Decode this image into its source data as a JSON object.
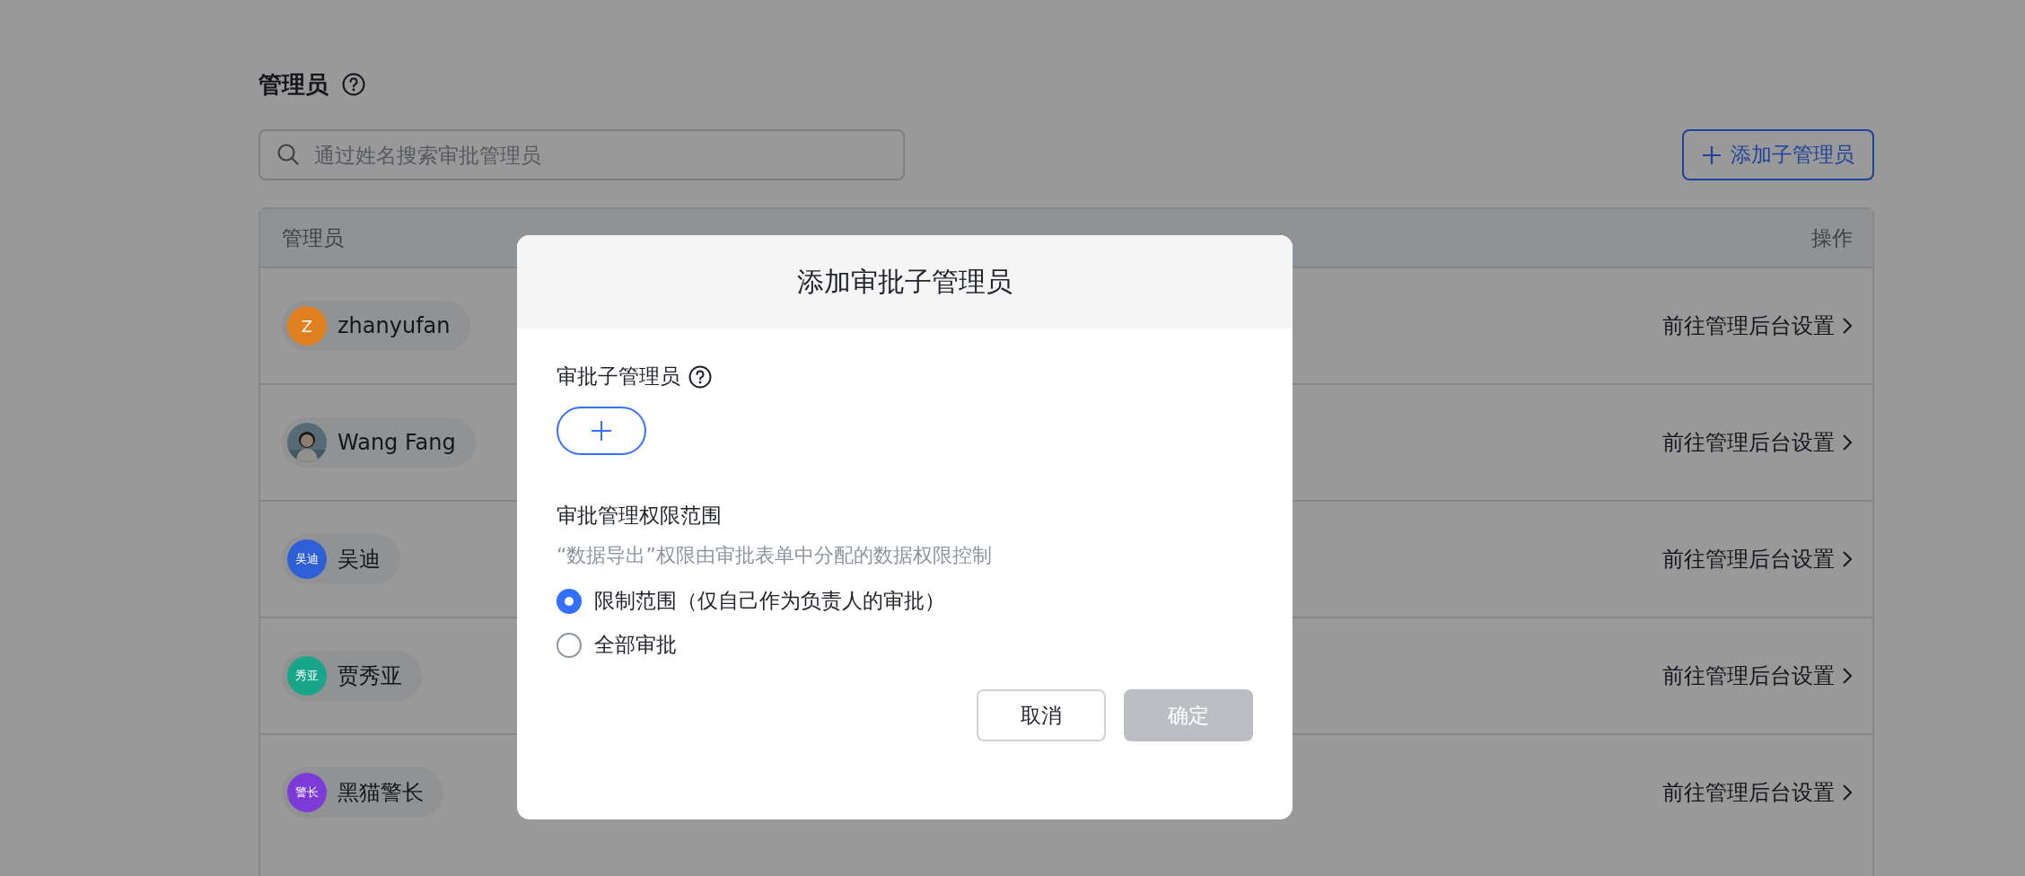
{
  "page": {
    "title": "管理员",
    "search": {
      "placeholder": "通过姓名搜索审批管理员"
    },
    "add_button": "添加子管理员"
  },
  "table": {
    "columns": [
      "管理员",
      "操作"
    ],
    "rows": [
      {
        "name": "zhanyufan",
        "avatar": {
          "kind": "initials",
          "text": "Z",
          "color": "#e07f1f"
        },
        "action": "前往管理后台设置"
      },
      {
        "name": "Wang Fang",
        "action": "前往管理后台设置"
      },
      {
        "name": "吴迪",
        "avatar": {
          "kind": "initials",
          "text": "吴迪",
          "color": "#2f5fd6"
        },
        "action": "前往管理后台设置"
      },
      {
        "name": "贾秀亚",
        "avatar": {
          "kind": "initials",
          "text": "秀亚",
          "color": "#17a68a"
        },
        "action": "前往管理后台设置"
      },
      {
        "name": "黑猫警长",
        "avatar": {
          "kind": "initials",
          "text": "警长",
          "color": "#7c3bd6"
        },
        "action": "前往管理后台设置"
      }
    ]
  },
  "dialog": {
    "title": "添加审批子管理员",
    "field_label": "审批子管理员",
    "scope_label": "审批管理权限范围",
    "scope_hint": "“数据导出”权限由审批表单中分配的数据权限控制",
    "options": [
      {
        "label": "限制范围（仅自己作为负责人的审批）",
        "selected": true
      },
      {
        "label": "全部审批",
        "selected": false
      }
    ],
    "buttons": [
      {
        "label": "取消",
        "kind": "secondary",
        "disabled": false
      },
      {
        "label": "确定",
        "kind": "primary",
        "disabled": true
      }
    ]
  }
}
